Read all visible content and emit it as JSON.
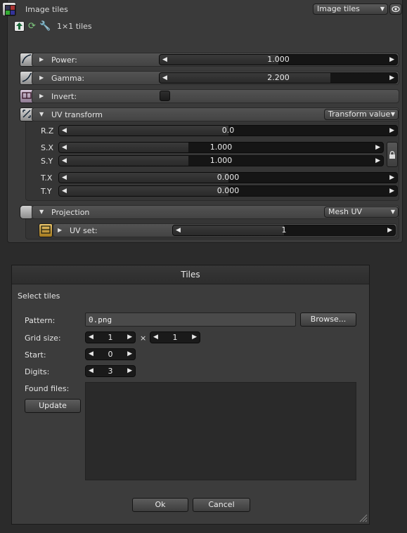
{
  "node": {
    "title": "Image tiles",
    "type_dropdown": "Image tiles",
    "tiles_label": "1×1 tiles",
    "icons": [
      "image-tiles-icon",
      "upload-icon",
      "refresh-icon",
      "wrench-icon",
      "eye-icon"
    ]
  },
  "params": {
    "power": {
      "label": "Power:",
      "value": "1.000",
      "fill": 0.5
    },
    "gamma": {
      "label": "Gamma:",
      "value": "2.200",
      "fill": 0.72
    },
    "invert": {
      "label": "Invert:",
      "checked": false
    },
    "uv_transform": {
      "label": "UV transform",
      "mode": "Transform value",
      "rz": {
        "label": "R.Z",
        "value": "0.0",
        "fill": 0.5
      },
      "sx": {
        "label": "S.X",
        "value": "1.000",
        "fill": 0.4
      },
      "sy": {
        "label": "S.Y",
        "value": "1.000",
        "fill": 0.4
      },
      "tx": {
        "label": "T.X",
        "value": "0.000",
        "fill": 0.5
      },
      "ty": {
        "label": "T.Y",
        "value": "0.000",
        "fill": 0.5
      }
    },
    "projection": {
      "label": "Projection",
      "mode": "Mesh UV",
      "uv_set": {
        "label": "UV set:",
        "value": "1",
        "fill": 0.5
      }
    }
  },
  "dialog": {
    "title": "Tiles",
    "section": "Select tiles",
    "pattern": {
      "label": "Pattern:",
      "value": "0.png"
    },
    "browse_label": "Browse...",
    "grid_size": {
      "label": "Grid size:",
      "x": "1",
      "times": "×",
      "y": "1"
    },
    "start": {
      "label": "Start:",
      "value": "0"
    },
    "digits": {
      "label": "Digits:",
      "value": "3"
    },
    "found_files": {
      "label": "Found files:",
      "items": []
    },
    "update_label": "Update",
    "ok_label": "Ok",
    "cancel_label": "Cancel"
  }
}
